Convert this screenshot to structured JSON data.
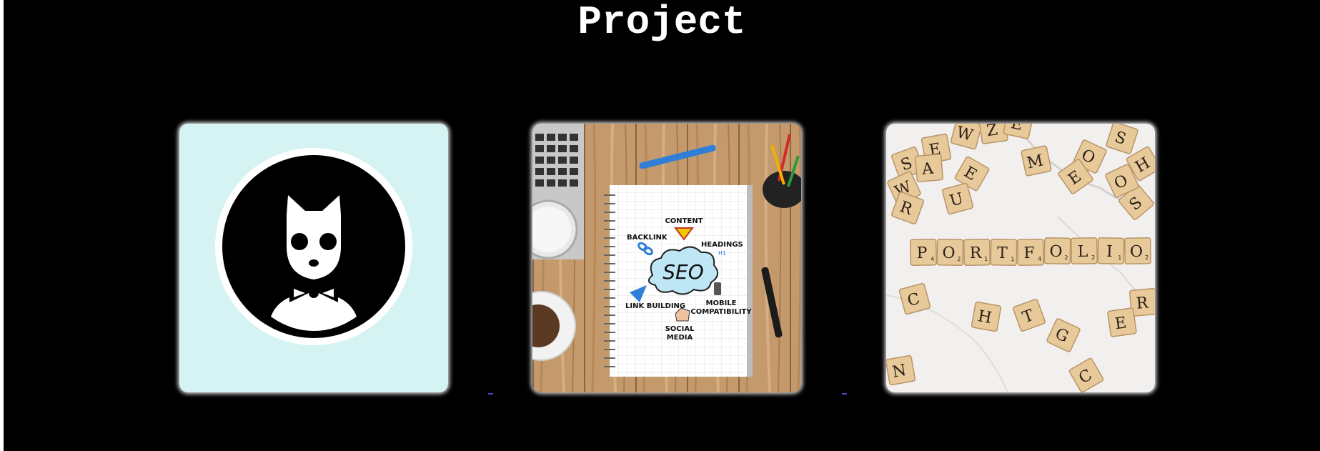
{
  "page": {
    "title": "Project",
    "background": "#000000"
  },
  "projects": [
    {
      "name": "cat-logo",
      "icon": "cat-with-bowtie-icon",
      "colors": {
        "background": "#d6f3f3",
        "ring": "#ffffff",
        "disc": "#000000"
      }
    },
    {
      "name": "seo-notebook",
      "notebook": {
        "center": "SEO",
        "labels": [
          "CONTENT",
          "BACKLINK",
          "HEADINGS",
          "LINK BUILDING",
          "MOBILE COMPATIBILITY",
          "SOCIAL MEDIA"
        ],
        "line_breaks": {
          "mobile": [
            "MOBILE",
            "COMPATIBILITY"
          ],
          "social": [
            "SOCIAL",
            "MEDIA"
          ],
          "heading_tag": "H1"
        }
      }
    },
    {
      "name": "portfolio-tiles",
      "word": "PORTFOLIO",
      "word_tiles": [
        {
          "letter": "P",
          "score": "4"
        },
        {
          "letter": "O",
          "score": "2"
        },
        {
          "letter": "R",
          "score": "1"
        },
        {
          "letter": "T",
          "score": "1"
        },
        {
          "letter": "F",
          "score": "4"
        },
        {
          "letter": "O",
          "score": "2"
        },
        {
          "letter": "L",
          "score": "2"
        },
        {
          "letter": "I",
          "score": "1"
        },
        {
          "letter": "O",
          "score": "2"
        }
      ],
      "scattered_letters": [
        "S",
        "E",
        "W",
        "Z",
        "E",
        "S",
        "H",
        "O",
        "M",
        "E",
        "W",
        "A",
        "E",
        "U",
        "S",
        "R",
        "O",
        "R",
        "C",
        "H",
        "T",
        "G",
        "E",
        "N",
        "C"
      ]
    }
  ]
}
